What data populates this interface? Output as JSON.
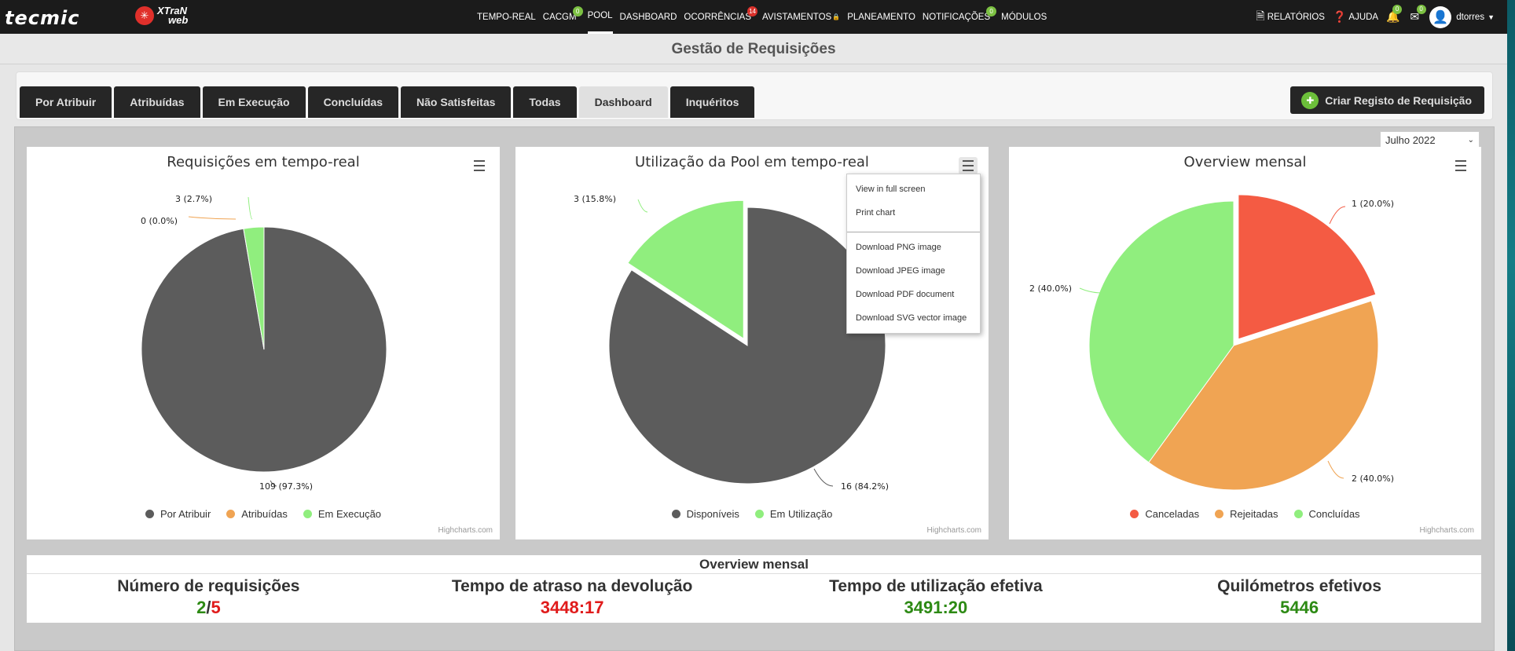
{
  "brand": {
    "tecmic": "tecmic",
    "xtran_top": "XTraN",
    "xtran_bottom": "web"
  },
  "nav": [
    {
      "label": "TEMPO-REAL"
    },
    {
      "label": "CACGM",
      "badge": "0",
      "badge_color": "#7cc142"
    },
    {
      "label": "POOL",
      "active": true
    },
    {
      "label": "DASHBOARD"
    },
    {
      "label": "OCORRÊNCIAS",
      "badge": "14",
      "badge_color": "#d9312b"
    },
    {
      "label": "AVISTAMENTOS",
      "lock": true
    },
    {
      "label": "PLANEAMENTO"
    },
    {
      "label": "NOTIFICAÇÕES",
      "badge": "0",
      "badge_color": "#7cc142"
    },
    {
      "label": "MÓDULOS"
    }
  ],
  "right_nav": {
    "reports": "RELATÓRIOS",
    "help": "AJUDA",
    "bell_badge": "0",
    "mail_badge": "0",
    "user": "dtorres"
  },
  "page_title": "Gestão de Requisições",
  "tabs": [
    "Por Atribuir",
    "Atribuídas",
    "Em Execução",
    "Concluídas",
    "Não Satisfeitas",
    "Todas",
    "Dashboard",
    "Inquéritos"
  ],
  "active_tab": "Dashboard",
  "create_button": "Criar Registo de Requisição",
  "month_select": "Julho 2022",
  "context_menu": [
    "View in full screen",
    "Print chart",
    "Download PNG image",
    "Download JPEG image",
    "Download PDF document",
    "Download SVG vector image"
  ],
  "credits": "Highcharts.com",
  "colors": {
    "dark": "#5c5c5c",
    "orange": "#f0a453",
    "green": "#90ee7e",
    "red": "#f45b43"
  },
  "chart_data": [
    {
      "type": "pie",
      "title": "Requisições em tempo-real",
      "series": [
        {
          "name": "",
          "slices": [
            {
              "name": "Por Atribuir",
              "value": 109,
              "label": "109 (97.3%)",
              "color": "#5c5c5c"
            },
            {
              "name": "Atribuídas",
              "value": 0,
              "label": "0 (0.0%)",
              "color": "#f0a453"
            },
            {
              "name": "Em Execução",
              "value": 3,
              "label": "3 (2.7%)",
              "color": "#90ee7e"
            }
          ]
        }
      ]
    },
    {
      "type": "pie",
      "title": "Utilização da Pool em tempo-real",
      "series": [
        {
          "name": "",
          "slices": [
            {
              "name": "Disponíveis",
              "value": 16,
              "label": "16 (84.2%)",
              "color": "#5c5c5c"
            },
            {
              "name": "Em Utilização",
              "value": 3,
              "label": "3 (15.8%)",
              "color": "#90ee7e"
            }
          ]
        }
      ]
    },
    {
      "type": "pie",
      "title": "Overview mensal",
      "series": [
        {
          "name": "",
          "slices": [
            {
              "name": "Canceladas",
              "value": 1,
              "label": "1 (20.0%)",
              "color": "#f45b43"
            },
            {
              "name": "Rejeitadas",
              "value": 2,
              "label": "2 (40.0%)",
              "color": "#f0a453"
            },
            {
              "name": "Concluídas",
              "value": 2,
              "label": "2 (40.0%)",
              "color": "#90ee7e"
            }
          ]
        }
      ]
    }
  ],
  "overview": {
    "title": "Overview mensal",
    "stats": [
      {
        "label": "Número de requisições",
        "value_a": "2",
        "sep": "/",
        "value_b": "5"
      },
      {
        "label": "Tempo de atraso na devolução",
        "value": "3448:17"
      },
      {
        "label": "Tempo de utilização efetiva",
        "value": "3491:20"
      },
      {
        "label": "Quilómetros efetivos",
        "value": "5446"
      }
    ]
  }
}
